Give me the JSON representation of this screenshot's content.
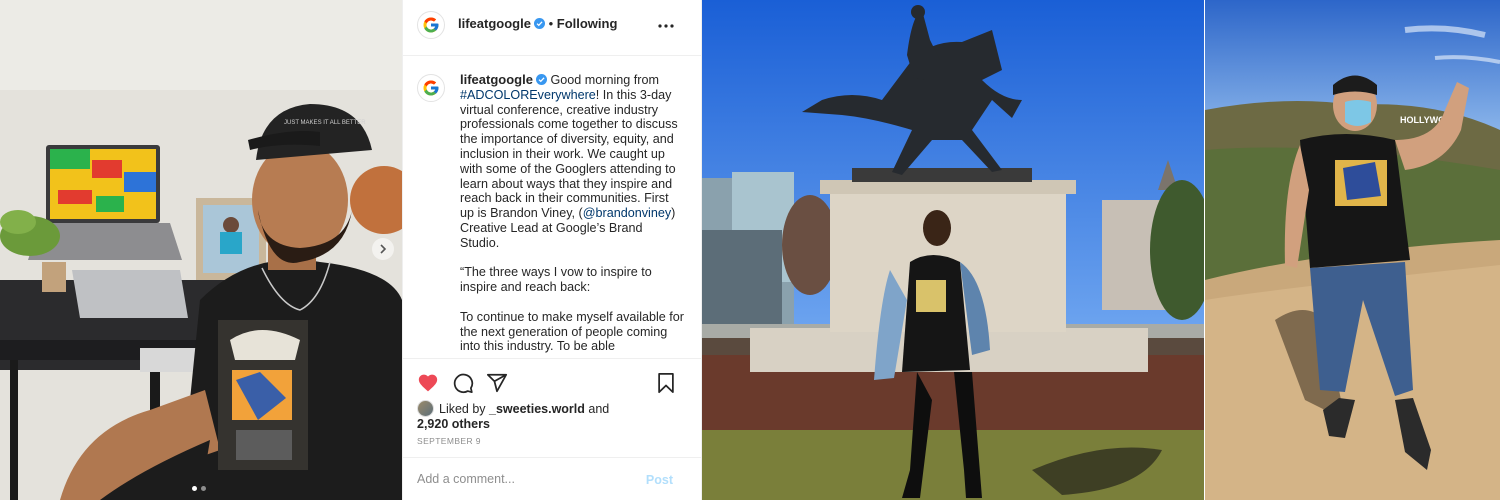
{
  "post": {
    "username": "lifeatgoogle",
    "follow_separator": "•",
    "follow_state": "Following",
    "caption_intro": "Good morning from ",
    "caption_hashtag": "#ADCOLOREverywhere",
    "caption_part2": "! In this 3-day virtual conference, creative industry professionals come together to discuss the importance of diversity, equity, and inclusion in their work. We caught up with some of the Googlers attending to learn about ways that they inspire and reach back in their communities. First up is Brandon Viney, (",
    "caption_mention": "@brandonviney",
    "caption_part3": ") Creative Lead at Google’s Brand Studio.\n\n“The three ways I vow to inspire to inspire and reach back:\n\nTo continue to make myself available for the next generation of people coming into this industry. To be able",
    "liked_by_prefix": "Liked by ",
    "liked_by_user": "_sweeties.world",
    "liked_by_and": " and",
    "liked_count": "2,920 others",
    "date": "SEPTEMBER 9",
    "comment_placeholder": "Add a comment...",
    "post_label": "Post"
  },
  "photos": {
    "cap_text": "JUST MAKES IT ALL BETTER",
    "hollywood_sign": "HOLLYWOOD"
  },
  "icons": {
    "heart": "heart-icon",
    "comment": "comment-icon",
    "share": "share-icon",
    "save": "bookmark-icon",
    "more": "more-icon",
    "verified": "verified-badge-icon"
  },
  "colors": {
    "heart": "#ed4956",
    "link": "#00376b",
    "verified": "#3897f0",
    "post_disabled": "#b2dffc"
  }
}
